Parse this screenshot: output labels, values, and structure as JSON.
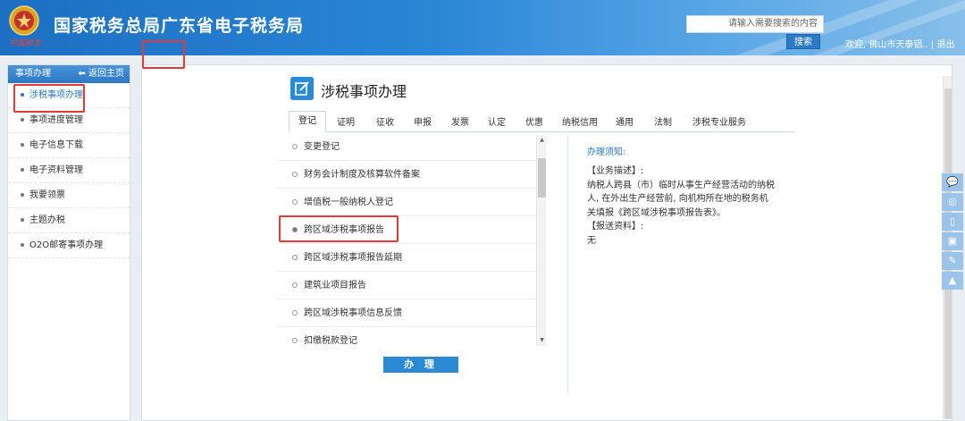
{
  "header": {
    "site_title": "国家税务总局广东省电子税务局",
    "brand_sub": "中国税务",
    "search_placeholder": "请输入需要搜索的内容",
    "search_button": "搜索",
    "welcome": "欢迎, 佛山市天泰铝.. | 退出"
  },
  "sidebar": {
    "title": "事项办理",
    "back_home": "返回主页",
    "items": [
      {
        "label": "涉税事项办理"
      },
      {
        "label": "事项进度管理"
      },
      {
        "label": "电子信息下载"
      },
      {
        "label": "电子资料管理"
      },
      {
        "label": "我要领票"
      },
      {
        "label": "主题办税"
      },
      {
        "label": "O2O邮寄事项办理"
      }
    ]
  },
  "main": {
    "page_title": "涉税事项办理",
    "tabs": [
      {
        "label": "登记"
      },
      {
        "label": "证明"
      },
      {
        "label": "征收"
      },
      {
        "label": "申报"
      },
      {
        "label": "发票"
      },
      {
        "label": "认定"
      },
      {
        "label": "优惠"
      },
      {
        "label": "纳税信用"
      },
      {
        "label": "通用"
      },
      {
        "label": "法制"
      },
      {
        "label": "涉税专业服务"
      }
    ],
    "list": [
      {
        "label": "变更登记"
      },
      {
        "label": "财务会计制度及核算软件备案"
      },
      {
        "label": "增值税一般纳税人登记"
      },
      {
        "label": "跨区域涉税事项报告"
      },
      {
        "label": "跨区域涉税事项报告延期"
      },
      {
        "label": "建筑业项目报告"
      },
      {
        "label": "跨区域涉税事项信息反馈"
      },
      {
        "label": "扣缴税款登记"
      }
    ],
    "submit_label": "办 理",
    "notice": {
      "title": "办理须知:",
      "line1": "【业务描述】:",
      "line2": "纳税人跨县（市）临时从事生产经营活动的纳税",
      "line3": "人, 在外出生产经营前, 向机构所在地的税务机",
      "line4": "关填报《跨区域涉税事项报告表》。",
      "line5": "【报送资料】:",
      "line6": "无"
    }
  },
  "colors": {
    "primary": "#2b8ad6",
    "highlight_box": "#e53935",
    "header_start": "#1c6fc2"
  }
}
